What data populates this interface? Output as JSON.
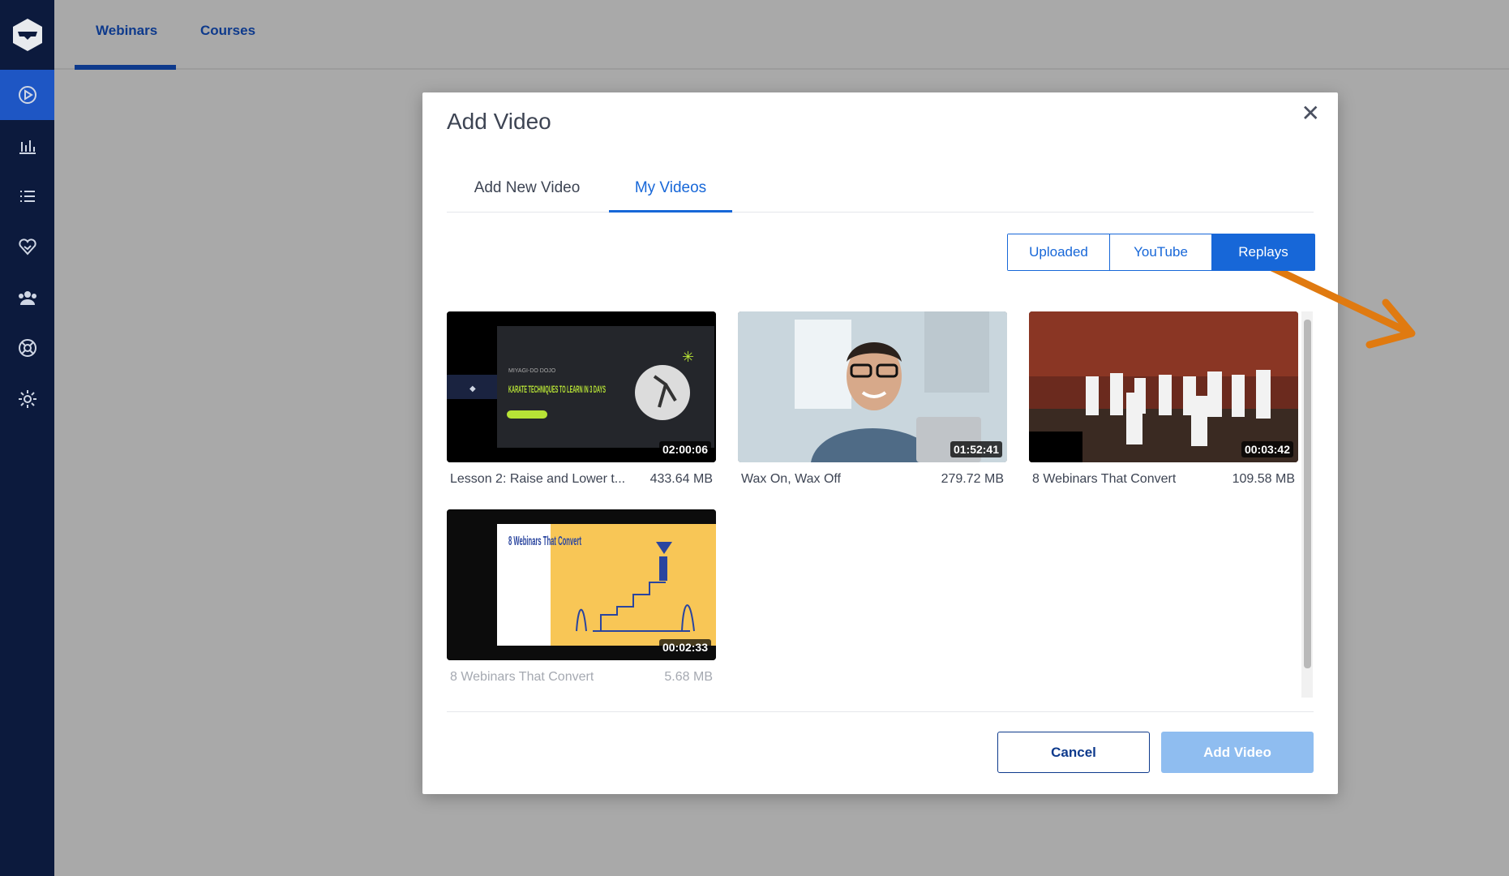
{
  "sidebar": {
    "items": [
      {
        "icon": "play-circle-icon",
        "active": true
      },
      {
        "icon": "bar-chart-icon",
        "active": false
      },
      {
        "icon": "list-icon",
        "active": false
      },
      {
        "icon": "heart-handshake-icon",
        "active": false
      },
      {
        "icon": "users-group-icon",
        "active": false
      },
      {
        "icon": "lifebuoy-icon",
        "active": false
      },
      {
        "icon": "gear-icon",
        "active": false
      }
    ]
  },
  "header": {
    "tabs": [
      {
        "label": "Webinars",
        "active": true
      },
      {
        "label": "Courses",
        "active": false
      }
    ]
  },
  "modal": {
    "title": "Add Video",
    "close_icon": "close-icon",
    "tabs": [
      {
        "label": "Add New Video",
        "active": false
      },
      {
        "label": "My Videos",
        "active": true
      }
    ],
    "filters": [
      {
        "label": "Uploaded",
        "active": false
      },
      {
        "label": "YouTube",
        "active": false
      },
      {
        "label": "Replays",
        "active": true
      }
    ],
    "videos": [
      {
        "name": "Lesson 2: Raise and Lower t...",
        "size": "433.64 MB",
        "duration": "02:00:06",
        "thumb_text": {
          "brand": "MIYAGI-DO DOJO",
          "headline": "KARATE TECHNIQUES TO LEARN IN 3 DAYS"
        }
      },
      {
        "name": "Wax On, Wax Off",
        "size": "279.72 MB",
        "duration": "01:52:41"
      },
      {
        "name": "8 Webinars That Convert",
        "size": "109.58 MB",
        "duration": "00:03:42"
      },
      {
        "name": "8 Webinars That Convert",
        "size": "5.68 MB",
        "duration": "00:02:33",
        "thumb_text": {
          "headline": "8 Webinars That Convert"
        }
      }
    ],
    "cancel_label": "Cancel",
    "add_label": "Add Video"
  },
  "colors": {
    "sidebar_bg": "#0c1a3d",
    "accent": "#1767d8",
    "annotation_arrow": "#e07a10"
  }
}
